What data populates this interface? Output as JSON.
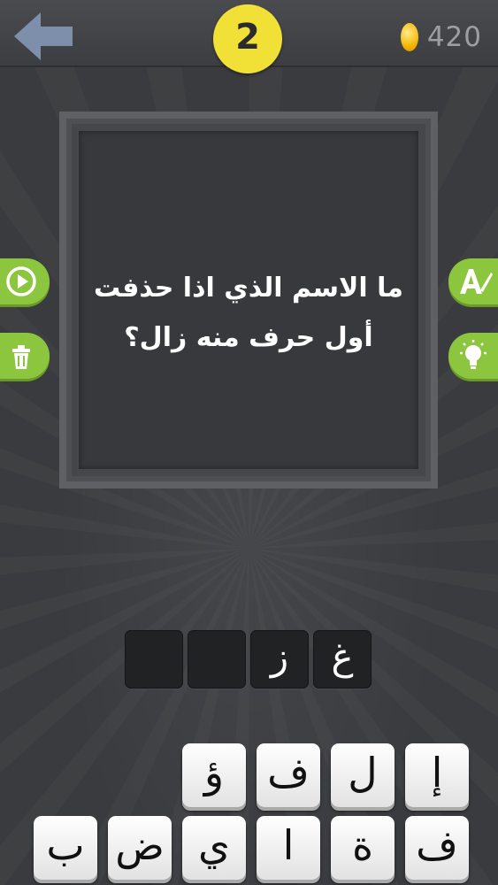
{
  "header": {
    "level": "2",
    "coins": "420"
  },
  "puzzle": {
    "question_line1": "ما الاسم الذي اذا حذفت",
    "question_line2": "أول حرف منه زال؟"
  },
  "answer_slots": [
    "غ",
    "ز",
    "",
    ""
  ],
  "keyboard": {
    "row1": [
      "إ",
      "ل",
      "ف",
      "ؤ"
    ],
    "row2": [
      "ف",
      "ة",
      "ا",
      "ي",
      "ض",
      "ب"
    ]
  },
  "colors": {
    "background": "#3a3b3e",
    "accent_green": "#8cc63f",
    "badge_yellow": "#f1e036",
    "coin_gold": "#f5b800"
  },
  "icons": {
    "back": "back-arrow-icon",
    "coin": "coin-icon",
    "play": "play-icon",
    "trash": "trash-icon",
    "reveal_letter": "reveal-letter-icon",
    "hint": "lightbulb-icon"
  }
}
